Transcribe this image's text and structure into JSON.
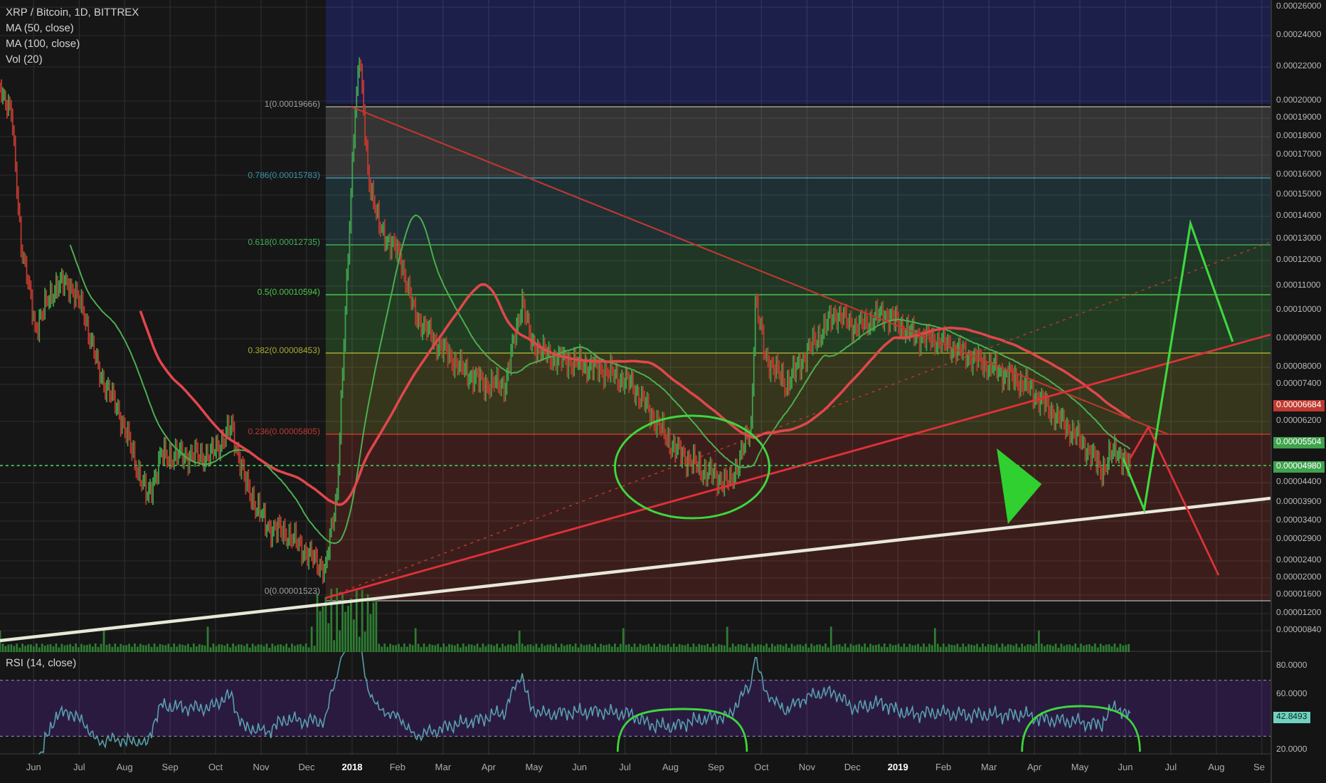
{
  "legend": [
    "XRP / Bitcoin, 1D, BITTREX",
    "MA (50, close)",
    "MA (100, close)",
    "Vol (20)"
  ],
  "fib_levels": [
    {
      "label": "1(0.00019666)",
      "color": "#9e9e9e"
    },
    {
      "label": "0.786(0.00015783)",
      "color": "#3f8fa6"
    },
    {
      "label": "0.618(0.00012735)",
      "color": "#3fae55"
    },
    {
      "label": "0.5(0.00010594)",
      "color": "#4cc24c"
    },
    {
      "label": "0.382(0.00008453)",
      "color": "#a6a832"
    },
    {
      "label": "0.236(0.00005805)",
      "color": "#c0392f"
    },
    {
      "label": "0(0.00001523)",
      "color": "#9e9e9e"
    }
  ],
  "price_axis": [
    "0.00026000",
    "0.00024000",
    "0.00022000",
    "0.00020000",
    "0.00019000",
    "0.00018000",
    "0.00017000",
    "0.00016000",
    "0.00015000",
    "0.00014000",
    "0.00013000",
    "0.00012000",
    "0.00011000",
    "0.00010000",
    "0.00009000",
    "0.00008000",
    "0.00007400",
    "0.00006200",
    "0.00004400",
    "0.00003900",
    "0.00003400",
    "0.00002900",
    "0.00002400",
    "0.00002000",
    "0.00001600",
    "0.00001200",
    "0.00000840"
  ],
  "price_badges": [
    {
      "text": "0.00006684",
      "color": "#c0392f"
    },
    {
      "text": "0.00005504",
      "color": "#3fa34d"
    },
    {
      "text": "0.00004980",
      "color": "#3fa34d"
    }
  ],
  "rsi_legend": "RSI (14, close)",
  "rsi_axis": [
    "80.0000",
    "60.0000",
    "20.0000"
  ],
  "rsi_badge": {
    "text": "42.8493",
    "color": "#6fd3c0"
  },
  "time_axis": [
    "Jun",
    "Jul",
    "Aug",
    "Sep",
    "Oct",
    "Nov",
    "Dec",
    "2018",
    "Feb",
    "Mar",
    "Apr",
    "May",
    "Jun",
    "Jul",
    "Aug",
    "Sep",
    "Oct",
    "Nov",
    "Dec",
    "2019",
    "Feb",
    "Mar",
    "Apr",
    "May",
    "Jun",
    "Jul",
    "Aug",
    "Se"
  ]
}
